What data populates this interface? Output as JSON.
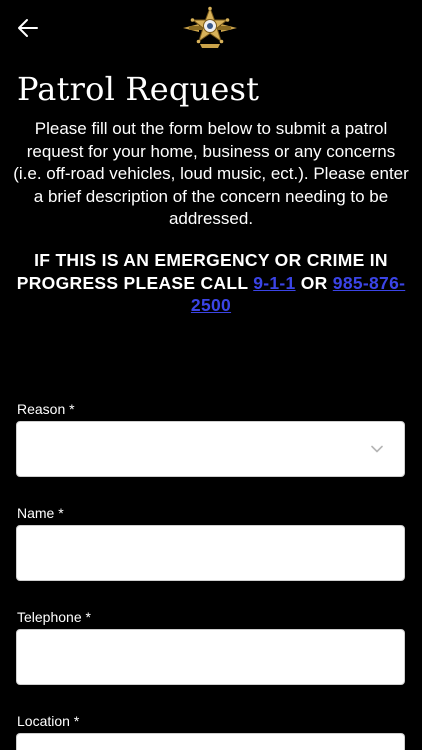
{
  "header": {
    "back_icon": "arrow-left-icon",
    "logo_icon": "sheriff-star-badge-icon"
  },
  "page": {
    "title": "Patrol Request",
    "intro": "Please fill out the form below to submit a patrol request for your home, business or any concerns (i.e. off-road vehicles, loud music, ect.). Please enter a brief description of the concern needing to be addressed.",
    "emergency_prefix": "IF THIS IS AN EMERGENCY OR CRIME IN PROGRESS PLEASE CALL",
    "emergency_link_1": "9-1-1",
    "emergency_or": "OR",
    "emergency_link_2": "985-876-2500"
  },
  "form": {
    "reason": {
      "label": "Reason *",
      "value": "",
      "icon": "chevron-down-icon"
    },
    "name": {
      "label": "Name *",
      "value": ""
    },
    "telephone": {
      "label": "Telephone *",
      "value": ""
    },
    "location": {
      "label": "Location *",
      "value": ""
    }
  },
  "colors": {
    "background": "#000000",
    "text": "#ffffff",
    "link": "#3b44e6",
    "badge_gold": "#c9a24a"
  }
}
